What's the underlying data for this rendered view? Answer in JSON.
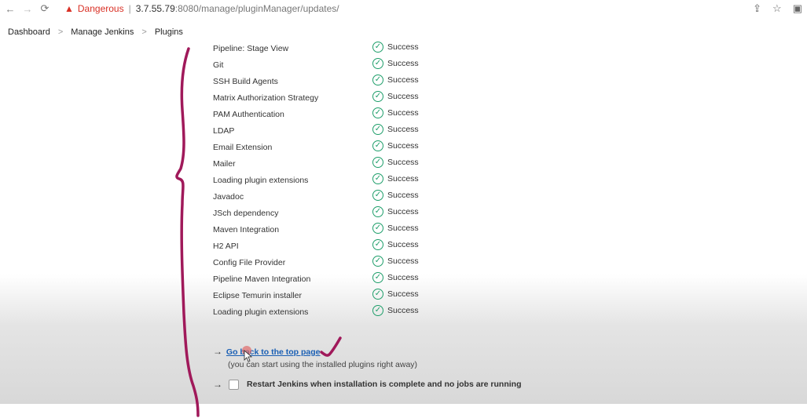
{
  "browser": {
    "security_label": "Dangerous",
    "url_host": "3.7.55.79",
    "url_path": ":8080/manage/pluginManager/updates/"
  },
  "breadcrumb": [
    "Dashboard",
    "Manage Jenkins",
    "Plugins"
  ],
  "plugins": [
    {
      "name": "Pipeline: Stage View",
      "status": "Success"
    },
    {
      "name": "Git",
      "status": "Success"
    },
    {
      "name": "SSH Build Agents",
      "status": "Success"
    },
    {
      "name": "Matrix Authorization Strategy",
      "status": "Success"
    },
    {
      "name": "PAM Authentication",
      "status": "Success"
    },
    {
      "name": "LDAP",
      "status": "Success"
    },
    {
      "name": "Email Extension",
      "status": "Success"
    },
    {
      "name": "Mailer",
      "status": "Success"
    },
    {
      "name": "Loading plugin extensions",
      "status": "Success"
    },
    {
      "name": "Javadoc",
      "status": "Success"
    },
    {
      "name": "JSch dependency",
      "status": "Success"
    },
    {
      "name": "Maven Integration",
      "status": "Success"
    },
    {
      "name": "H2 API",
      "status": "Success"
    },
    {
      "name": "Config File Provider",
      "status": "Success"
    },
    {
      "name": "Pipeline Maven Integration",
      "status": "Success"
    },
    {
      "name": "Eclipse Temurin installer",
      "status": "Success"
    },
    {
      "name": "Loading plugin extensions",
      "status": "Success"
    }
  ],
  "actions": {
    "top_link": "Go back to the top page",
    "top_hint": "(you can start using the installed plugins right away)",
    "restart_label": "Restart Jenkins when installation is complete and no jobs are running"
  },
  "colors": {
    "success": "#1e9e6a",
    "danger": "#d93025",
    "annotation": "#a0195a"
  }
}
